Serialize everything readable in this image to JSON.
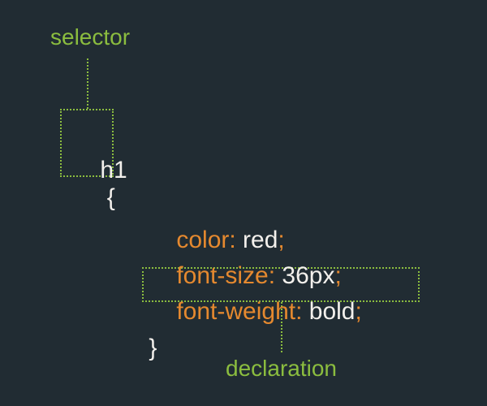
{
  "labels": {
    "selector": "selector",
    "declaration": "declaration"
  },
  "code": {
    "selector": "h1",
    "openBrace": "{",
    "closeBrace": "}",
    "colonSp": ": ",
    "semi": ";",
    "decls": [
      {
        "prop": "color",
        "val": "red"
      },
      {
        "prop": "font-size",
        "val": "36px"
      },
      {
        "prop": "font-weight",
        "val": "bold"
      }
    ]
  },
  "palette": {
    "bg": "#212c33",
    "label": "#8bbd3f",
    "property": "#e5892f",
    "value": "#f3f0ec"
  }
}
